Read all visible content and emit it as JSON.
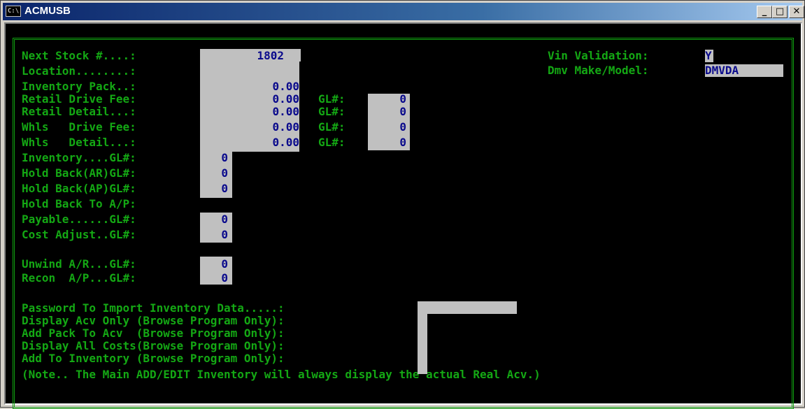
{
  "window": {
    "title": "ACMUSB",
    "icon_text": "C:\\",
    "min": "_",
    "max": "□",
    "close": "✕"
  },
  "labels": {
    "next_stock": "Next Stock #....:",
    "location": "Location........:",
    "inventory_pack": "Inventory Pack..:",
    "retail_drive_fee": "Retail Drive Fee:",
    "retail_detail": "Retail Detail...:",
    "whls_drive_fee": "Whls   Drive Fee:",
    "whls_detail": "Whls   Detail...:",
    "inventory_gl": "Inventory....GL#:",
    "holdback_ar_gl": "Hold Back(AR)GL#:",
    "holdback_ap_gl": "Hold Back(AP)GL#:",
    "holdback_to_ap": "Hold Back To A/P:",
    "payable_gl": "Payable......GL#:",
    "cost_adjust_gl": "Cost Adjust..GL#:",
    "unwind_ar_gl": "Unwind A/R...GL#:",
    "recon_ap_gl": "Recon  A/P...GL#:",
    "gl": "GL#:",
    "vin_validation": "Vin Validation:",
    "dmv_make_model": "Dmv Make/Model:",
    "password_import": "Password To Import Inventory Data.....:",
    "display_acv_only": "Display Acv Only (Browse Program Only):",
    "add_pack_to_acv": "Add Pack To Acv  (Browse Program Only):",
    "display_all_costs": "Display All Costs(Browse Program Only):",
    "add_to_inventory": "Add To Inventory (Browse Program Only):",
    "note": "(Note.. The Main ADD/EDIT Inventory will always display the actual Real Acv.)"
  },
  "values": {
    "next_stock": "1802",
    "inventory_pack": "0.00",
    "retail_drive_fee": "0.00",
    "retail_detail": "0.00",
    "whls_drive_fee": "0.00",
    "whls_detail": "0.00",
    "retail_drive_fee_gl": "0",
    "retail_detail_gl": "0",
    "whls_drive_fee_gl": "0",
    "whls_detail_gl": "0",
    "inventory_gl": "0",
    "holdback_ar_gl": "0",
    "holdback_ap_gl": "0",
    "payable_gl": "0",
    "cost_adjust_gl": "0",
    "unwind_ar_gl": "0",
    "recon_ap_gl": "0",
    "vin_validation": "Y",
    "dmv_make_model": "DMVDA"
  }
}
